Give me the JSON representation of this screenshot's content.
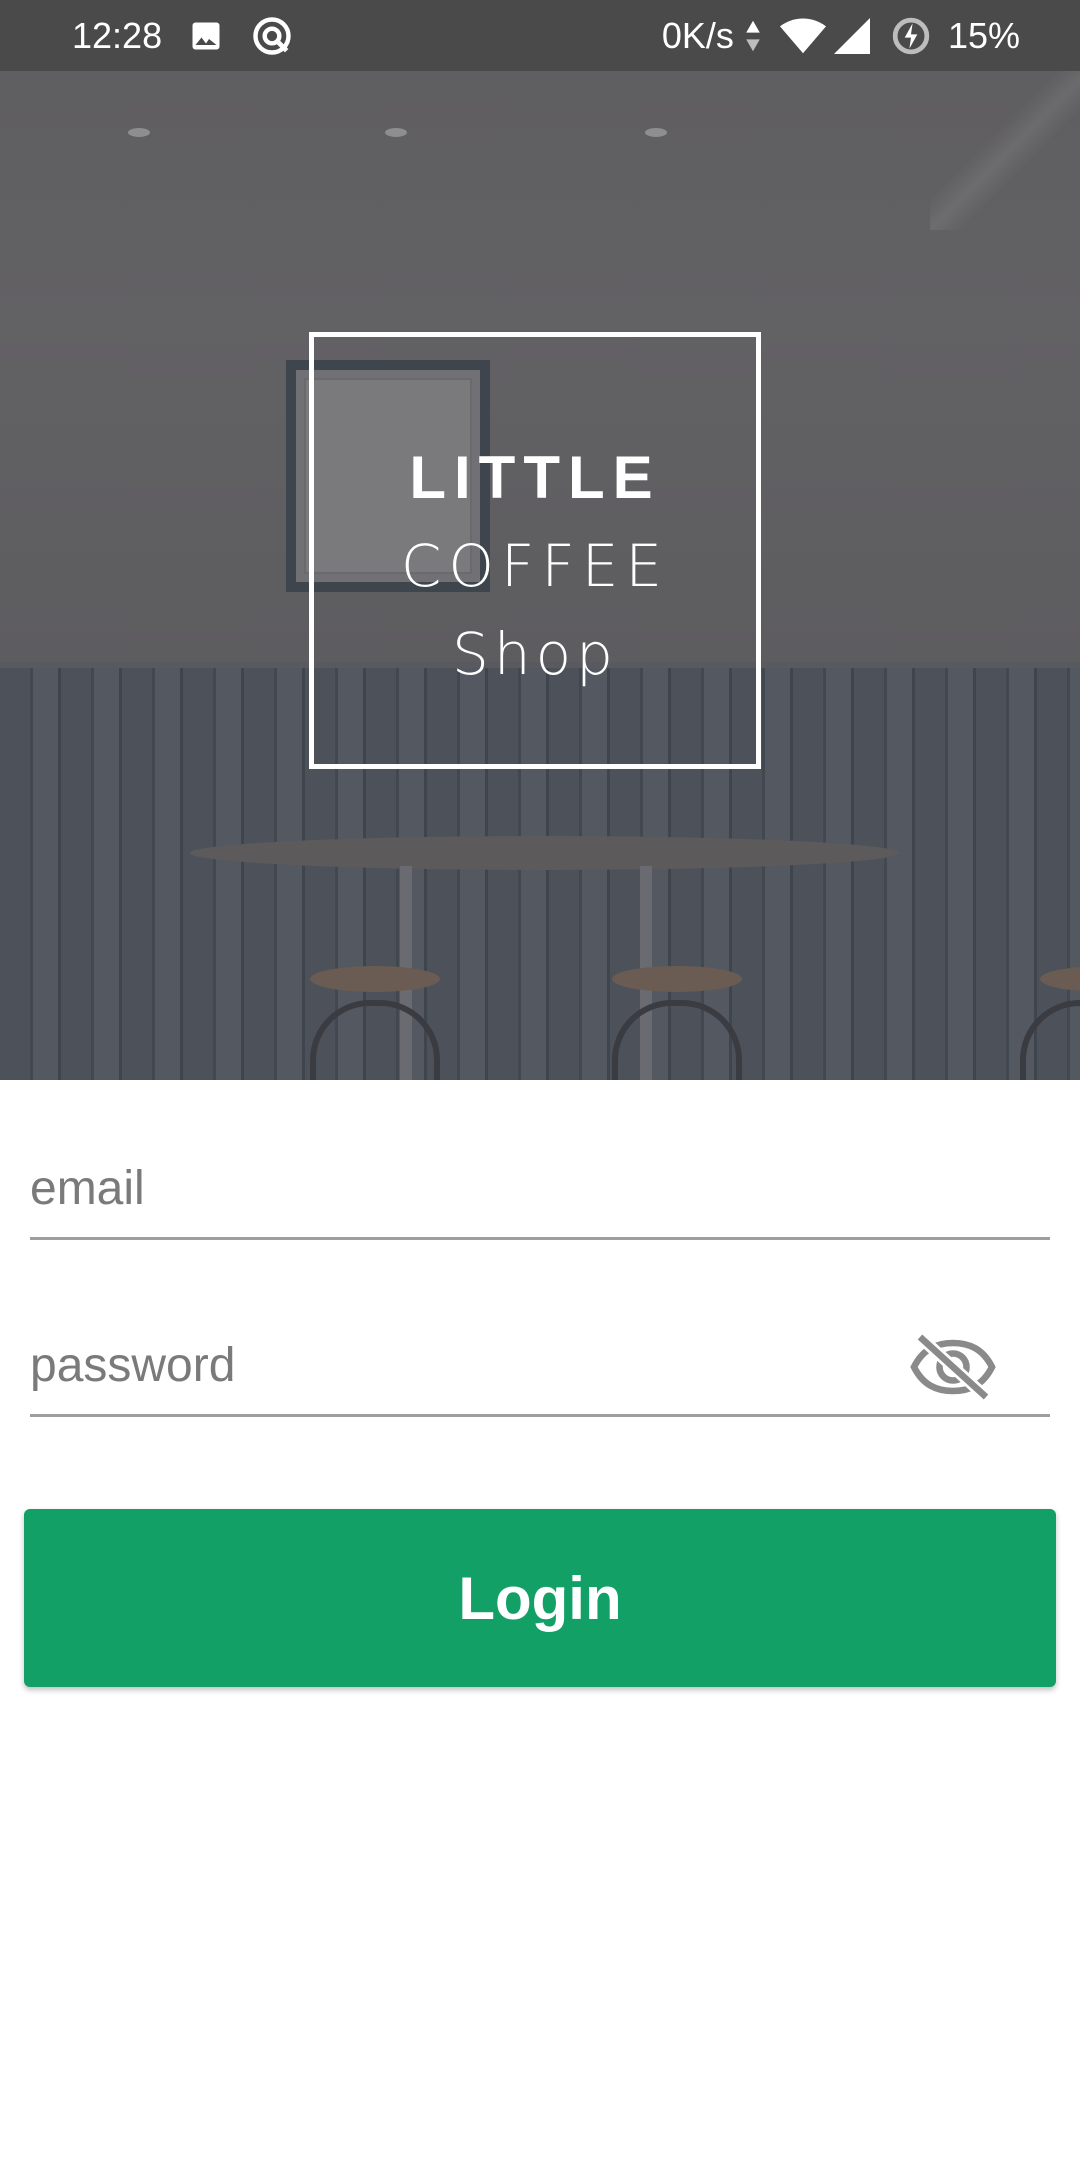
{
  "status_bar": {
    "time": "12:28",
    "network_speed": "0K/s",
    "battery": "15%",
    "icons": [
      "image-icon",
      "sync-icon",
      "data-arrows-icon",
      "wifi-icon",
      "signal-icon",
      "battery-saver-icon"
    ]
  },
  "logo": {
    "line1": "LITTLE",
    "line2": "COFFEE",
    "line3": "Shop"
  },
  "form": {
    "email_placeholder": "email",
    "password_placeholder": "password",
    "password_toggle_icon": "eye-off-icon",
    "login_label": "Login"
  },
  "colors": {
    "primary": "#12a067",
    "status_bar": "#4a4a4a",
    "underline": "#9e9e9e",
    "placeholder": "#7a7a7a"
  }
}
